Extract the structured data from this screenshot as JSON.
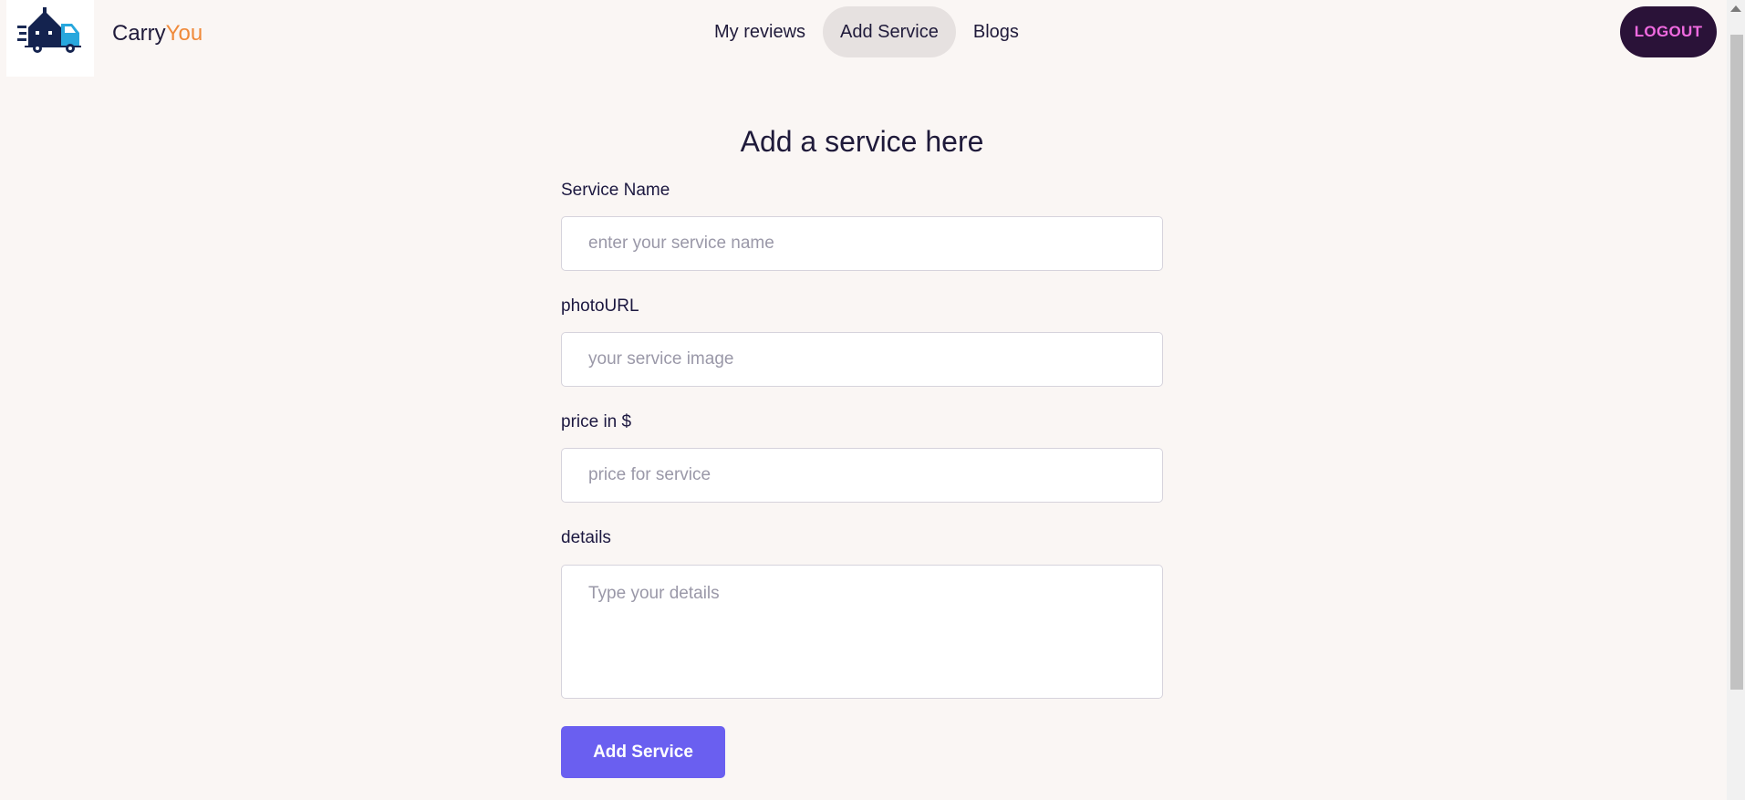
{
  "brand": {
    "name_part1": "Carry",
    "name_part2": "You",
    "accent_color": "#f08a3a",
    "logo_icon": "moving-truck-house-icon"
  },
  "nav": {
    "items": [
      {
        "label": "My reviews",
        "active": false
      },
      {
        "label": "Add Service",
        "active": true
      },
      {
        "label": "Blogs",
        "active": false
      }
    ]
  },
  "header": {
    "logout_label": "LOGOUT"
  },
  "form": {
    "title": "Add a service here",
    "fields": {
      "service_name": {
        "label": "Service Name",
        "placeholder": "enter your service name",
        "value": ""
      },
      "photo_url": {
        "label": "photoURL",
        "placeholder": "your service image",
        "value": ""
      },
      "price": {
        "label": "price in $",
        "placeholder": "price for service",
        "value": ""
      },
      "details": {
        "label": "details",
        "placeholder": "Type your details",
        "value": ""
      }
    },
    "submit_label": "Add Service"
  },
  "colors": {
    "background": "#faf6f4",
    "primary_button": "#6a5ff0",
    "logout_bg": "#2a1238",
    "logout_text": "#f06ae0"
  }
}
